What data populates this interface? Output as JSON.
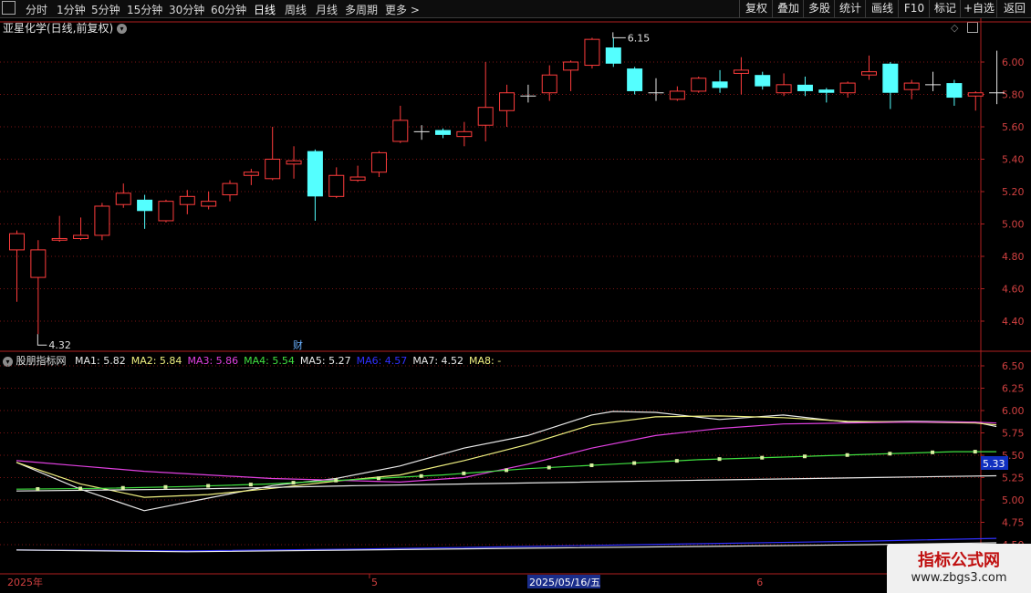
{
  "toolbar": {
    "items": [
      "分时",
      "1分钟",
      "5分钟",
      "15分钟",
      "30分钟",
      "60分钟",
      "日线",
      "周线",
      "月线",
      "多周期",
      "更多 >"
    ],
    "active": "日线",
    "right_items": [
      "复权",
      "叠加",
      "多股",
      "统计",
      "画线",
      "F10",
      "标记",
      "+自选",
      "返回"
    ]
  },
  "main_panel": {
    "title": "亚星化学(日线,前复权)",
    "y_ticks": [
      "6.00",
      "5.80",
      "5.60",
      "5.40",
      "5.20",
      "5.00",
      "4.80",
      "4.60",
      "4.40"
    ],
    "high_label": "6.15",
    "low_label": "4.32",
    "finance_marker": "财"
  },
  "sub_panel": {
    "indicator_name": "股朋指标网",
    "ma_labels": [
      {
        "name": "MA1",
        "value": "5.82",
        "color": "#e8e8e8"
      },
      {
        "name": "MA2",
        "value": "5.84",
        "color": "#f0f080"
      },
      {
        "name": "MA3",
        "value": "5.86",
        "color": "#e040e0"
      },
      {
        "name": "MA4",
        "value": "5.54",
        "color": "#40e040"
      },
      {
        "name": "MA5",
        "value": "5.27",
        "color": "#e8e8e8"
      },
      {
        "name": "MA6",
        "value": "4.57",
        "color": "#3030ff"
      },
      {
        "name": "MA7",
        "value": "4.52",
        "color": "#e8e8e8"
      },
      {
        "name": "MA8",
        "value": "-",
        "color": "#f0f080"
      }
    ],
    "y_ticks": [
      "6.50",
      "6.25",
      "6.00",
      "5.75",
      "5.50",
      "5.25",
      "5.00",
      "4.75",
      "4.50"
    ],
    "current_value": "5.33"
  },
  "x_axis": {
    "labels": [
      "2025年",
      "5",
      "2025/05/16/五",
      "6"
    ]
  },
  "watermark": {
    "line1": "指标公式网",
    "line2": "www.zbgs3.com"
  },
  "colors": {
    "up": "#ff3c3c",
    "down": "#54ffff",
    "grid": "#7a1414",
    "axis": "#b02020"
  },
  "chart_data": {
    "type": "candlestick",
    "ylim": [
      4.25,
      6.2
    ],
    "candles": [
      {
        "o": 4.84,
        "c": 4.94,
        "h": 4.96,
        "l": 4.52
      },
      {
        "o": 4.67,
        "c": 4.84,
        "h": 4.9,
        "l": 4.32
      },
      {
        "o": 4.9,
        "c": 4.91,
        "h": 5.05,
        "l": 4.89
      },
      {
        "o": 4.91,
        "c": 4.93,
        "h": 5.04,
        "l": 4.9
      },
      {
        "o": 4.93,
        "c": 5.11,
        "h": 5.13,
        "l": 4.9
      },
      {
        "o": 5.12,
        "c": 5.19,
        "h": 5.25,
        "l": 5.1
      },
      {
        "o": 5.15,
        "c": 5.08,
        "h": 5.18,
        "l": 4.97
      },
      {
        "o": 5.02,
        "c": 5.14,
        "h": 5.15,
        "l": 5.01
      },
      {
        "o": 5.12,
        "c": 5.17,
        "h": 5.21,
        "l": 5.06
      },
      {
        "o": 5.11,
        "c": 5.14,
        "h": 5.2,
        "l": 5.09
      },
      {
        "o": 5.18,
        "c": 5.25,
        "h": 5.27,
        "l": 5.14
      },
      {
        "o": 5.3,
        "c": 5.32,
        "h": 5.34,
        "l": 5.24
      },
      {
        "o": 5.28,
        "c": 5.4,
        "h": 5.6,
        "l": 5.27
      },
      {
        "o": 5.37,
        "c": 5.39,
        "h": 5.48,
        "l": 5.28
      },
      {
        "o": 5.45,
        "c": 5.17,
        "h": 5.46,
        "l": 5.02
      },
      {
        "o": 5.17,
        "c": 5.3,
        "h": 5.35,
        "l": 5.16
      },
      {
        "o": 5.27,
        "c": 5.29,
        "h": 5.36,
        "l": 5.26
      },
      {
        "o": 5.32,
        "c": 5.44,
        "h": 5.45,
        "l": 5.29
      },
      {
        "o": 5.51,
        "c": 5.64,
        "h": 5.73,
        "l": 5.5
      },
      {
        "o": 5.57,
        "c": 5.57,
        "h": 5.61,
        "l": 5.52
      },
      {
        "o": 5.58,
        "c": 5.55,
        "h": 5.59,
        "l": 5.53
      },
      {
        "o": 5.54,
        "c": 5.57,
        "h": 5.63,
        "l": 5.48
      },
      {
        "o": 5.61,
        "c": 5.72,
        "h": 6.0,
        "l": 5.51
      },
      {
        "o": 5.7,
        "c": 5.81,
        "h": 5.86,
        "l": 5.6
      },
      {
        "o": 5.79,
        "c": 5.79,
        "h": 5.86,
        "l": 5.75
      },
      {
        "o": 5.81,
        "c": 5.92,
        "h": 5.98,
        "l": 5.76
      },
      {
        "o": 5.95,
        "c": 6.0,
        "h": 6.01,
        "l": 5.82
      },
      {
        "o": 5.98,
        "c": 6.14,
        "h": 6.15,
        "l": 5.96
      },
      {
        "o": 6.09,
        "c": 5.99,
        "h": 6.15,
        "l": 5.97
      },
      {
        "o": 5.96,
        "c": 5.82,
        "h": 5.97,
        "l": 5.8
      },
      {
        "o": 5.81,
        "c": 5.81,
        "h": 5.9,
        "l": 5.76
      },
      {
        "o": 5.77,
        "c": 5.82,
        "h": 5.85,
        "l": 5.76
      },
      {
        "o": 5.82,
        "c": 5.9,
        "h": 5.91,
        "l": 5.81
      },
      {
        "o": 5.88,
        "c": 5.84,
        "h": 5.95,
        "l": 5.81
      },
      {
        "o": 5.93,
        "c": 5.95,
        "h": 6.03,
        "l": 5.8
      },
      {
        "o": 5.92,
        "c": 5.85,
        "h": 5.94,
        "l": 5.83
      },
      {
        "o": 5.81,
        "c": 5.86,
        "h": 5.93,
        "l": 5.79
      },
      {
        "o": 5.86,
        "c": 5.82,
        "h": 5.91,
        "l": 5.79
      },
      {
        "o": 5.83,
        "c": 5.81,
        "h": 5.84,
        "l": 5.75
      },
      {
        "o": 5.81,
        "c": 5.87,
        "h": 5.88,
        "l": 5.78
      },
      {
        "o": 5.92,
        "c": 5.94,
        "h": 6.04,
        "l": 5.89
      },
      {
        "o": 5.99,
        "c": 5.81,
        "h": 6.0,
        "l": 5.71
      },
      {
        "o": 5.83,
        "c": 5.87,
        "h": 5.89,
        "l": 5.77
      },
      {
        "o": 5.86,
        "c": 5.86,
        "h": 5.94,
        "l": 5.82
      },
      {
        "o": 5.87,
        "c": 5.78,
        "h": 5.89,
        "l": 5.73
      },
      {
        "o": 5.79,
        "c": 5.81,
        "h": 5.82,
        "l": 5.7
      },
      {
        "o": 5.81,
        "c": 5.81,
        "h": 6.07,
        "l": 5.74
      }
    ],
    "indicator": {
      "ylim": [
        4.45,
        6.6
      ],
      "series": [
        {
          "name": "MA1",
          "color": "#e8e8e8",
          "x": [
            0,
            3,
            6,
            9,
            12,
            15,
            18,
            21,
            24,
            27,
            28,
            30,
            33,
            36,
            39,
            42,
            45,
            46
          ],
          "y": [
            5.42,
            5.12,
            4.88,
            5.02,
            5.16,
            5.24,
            5.38,
            5.58,
            5.72,
            5.95,
            5.99,
            5.98,
            5.9,
            5.95,
            5.87,
            5.88,
            5.87,
            5.82
          ]
        },
        {
          "name": "MA2",
          "color": "#f0f080",
          "x": [
            0,
            3,
            6,
            9,
            12,
            15,
            18,
            21,
            24,
            27,
            30,
            33,
            36,
            39,
            42,
            45,
            46
          ],
          "y": [
            5.42,
            5.18,
            5.03,
            5.06,
            5.13,
            5.21,
            5.28,
            5.44,
            5.62,
            5.84,
            5.93,
            5.94,
            5.92,
            5.88,
            5.87,
            5.86,
            5.84
          ]
        },
        {
          "name": "MA3",
          "color": "#e040e0",
          "x": [
            0,
            3,
            6,
            9,
            12,
            15,
            18,
            21,
            24,
            27,
            30,
            33,
            36,
            39,
            42,
            45,
            46
          ],
          "y": [
            5.44,
            5.38,
            5.32,
            5.28,
            5.24,
            5.22,
            5.2,
            5.25,
            5.4,
            5.58,
            5.72,
            5.8,
            5.85,
            5.86,
            5.87,
            5.87,
            5.86
          ]
        },
        {
          "name": "MA4",
          "color": "#40e040",
          "x": [
            0,
            4,
            8,
            12,
            16,
            20,
            24,
            28,
            32,
            36,
            40,
            44,
            46
          ],
          "y": [
            5.12,
            5.13,
            5.15,
            5.18,
            5.23,
            5.28,
            5.35,
            5.4,
            5.45,
            5.48,
            5.51,
            5.54,
            5.54
          ]
        },
        {
          "name": "MA5",
          "color": "#e8e8e8",
          "x": [
            0,
            8,
            16,
            24,
            32,
            40,
            46
          ],
          "y": [
            5.1,
            5.12,
            5.16,
            5.19,
            5.22,
            5.25,
            5.27
          ]
        },
        {
          "name": "MA6",
          "color": "#3030ff",
          "x": [
            0,
            8,
            16,
            24,
            32,
            40,
            46
          ],
          "y": [
            4.44,
            4.43,
            4.45,
            4.48,
            4.51,
            4.54,
            4.57
          ]
        },
        {
          "name": "MA7",
          "color": "#e8e8e8",
          "x": [
            0,
            8,
            16,
            24,
            32,
            40,
            46
          ],
          "y": [
            4.44,
            4.42,
            4.44,
            4.46,
            4.48,
            4.5,
            4.52
          ]
        }
      ],
      "dots": [
        1,
        3,
        5,
        7,
        9,
        11,
        13,
        15,
        17,
        19,
        21,
        23,
        25,
        27,
        29,
        31,
        33,
        35,
        37,
        39,
        41,
        43,
        45
      ]
    }
  }
}
